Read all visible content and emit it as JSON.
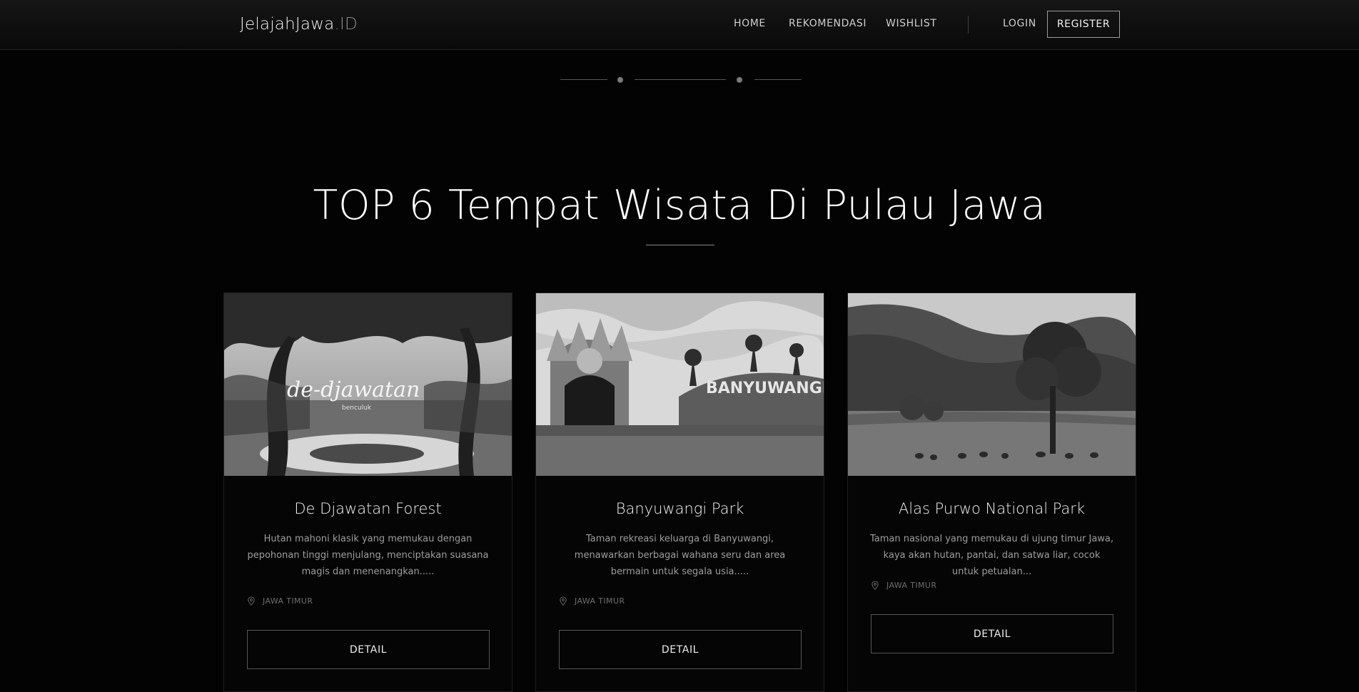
{
  "nav": {
    "brand_main": "JelajahJawa",
    "brand_suffix": ".ID",
    "links": [
      "HOME",
      "REKOMENDASI",
      "WISHLIST"
    ],
    "login": "LOGIN",
    "register": "REGISTER"
  },
  "section": {
    "title": "TOP 6 Tempat Wisata Di Pulau Jawa"
  },
  "cards": [
    {
      "title": "De Djawatan Forest",
      "description": "Hutan mahoni klasik yang memukau dengan pepohonan tinggi menjulang, menciptakan suasana magis dan menenangkan.....",
      "location": "JAWA TIMUR",
      "button": "DETAIL",
      "image_text": "de-djawatan",
      "image_subtext": "benculuk"
    },
    {
      "title": "Banyuwangi Park",
      "description": "Taman rekreasi keluarga di Banyuwangi, menawarkan berbagai wahana seru dan area bermain untuk segala usia.....",
      "location": "JAWA TIMUR",
      "button": "DETAIL",
      "image_text": "BANYUWANGI PARK"
    },
    {
      "title": "Alas Purwo National Park",
      "description": "Taman nasional yang memukau di ujung timur Jawa, kaya akan hutan, pantai, dan satwa liar, cocok untuk petualan...",
      "location": "JAWA TIMUR",
      "button": "DETAIL"
    }
  ],
  "icons": {
    "location": "map-pin-icon"
  }
}
